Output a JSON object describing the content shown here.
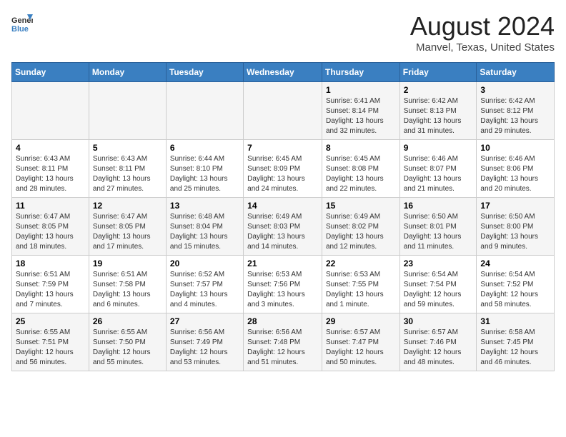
{
  "logo": {
    "text_general": "General",
    "text_blue": "Blue"
  },
  "header": {
    "title": "August 2024",
    "subtitle": "Manvel, Texas, United States"
  },
  "days_of_week": [
    "Sunday",
    "Monday",
    "Tuesday",
    "Wednesday",
    "Thursday",
    "Friday",
    "Saturday"
  ],
  "weeks": [
    [
      {
        "day": "",
        "info": ""
      },
      {
        "day": "",
        "info": ""
      },
      {
        "day": "",
        "info": ""
      },
      {
        "day": "",
        "info": ""
      },
      {
        "day": "1",
        "info": "Sunrise: 6:41 AM\nSunset: 8:14 PM\nDaylight: 13 hours\nand 32 minutes."
      },
      {
        "day": "2",
        "info": "Sunrise: 6:42 AM\nSunset: 8:13 PM\nDaylight: 13 hours\nand 31 minutes."
      },
      {
        "day": "3",
        "info": "Sunrise: 6:42 AM\nSunset: 8:12 PM\nDaylight: 13 hours\nand 29 minutes."
      }
    ],
    [
      {
        "day": "4",
        "info": "Sunrise: 6:43 AM\nSunset: 8:11 PM\nDaylight: 13 hours\nand 28 minutes."
      },
      {
        "day": "5",
        "info": "Sunrise: 6:43 AM\nSunset: 8:11 PM\nDaylight: 13 hours\nand 27 minutes."
      },
      {
        "day": "6",
        "info": "Sunrise: 6:44 AM\nSunset: 8:10 PM\nDaylight: 13 hours\nand 25 minutes."
      },
      {
        "day": "7",
        "info": "Sunrise: 6:45 AM\nSunset: 8:09 PM\nDaylight: 13 hours\nand 24 minutes."
      },
      {
        "day": "8",
        "info": "Sunrise: 6:45 AM\nSunset: 8:08 PM\nDaylight: 13 hours\nand 22 minutes."
      },
      {
        "day": "9",
        "info": "Sunrise: 6:46 AM\nSunset: 8:07 PM\nDaylight: 13 hours\nand 21 minutes."
      },
      {
        "day": "10",
        "info": "Sunrise: 6:46 AM\nSunset: 8:06 PM\nDaylight: 13 hours\nand 20 minutes."
      }
    ],
    [
      {
        "day": "11",
        "info": "Sunrise: 6:47 AM\nSunset: 8:05 PM\nDaylight: 13 hours\nand 18 minutes."
      },
      {
        "day": "12",
        "info": "Sunrise: 6:47 AM\nSunset: 8:05 PM\nDaylight: 13 hours\nand 17 minutes."
      },
      {
        "day": "13",
        "info": "Sunrise: 6:48 AM\nSunset: 8:04 PM\nDaylight: 13 hours\nand 15 minutes."
      },
      {
        "day": "14",
        "info": "Sunrise: 6:49 AM\nSunset: 8:03 PM\nDaylight: 13 hours\nand 14 minutes."
      },
      {
        "day": "15",
        "info": "Sunrise: 6:49 AM\nSunset: 8:02 PM\nDaylight: 13 hours\nand 12 minutes."
      },
      {
        "day": "16",
        "info": "Sunrise: 6:50 AM\nSunset: 8:01 PM\nDaylight: 13 hours\nand 11 minutes."
      },
      {
        "day": "17",
        "info": "Sunrise: 6:50 AM\nSunset: 8:00 PM\nDaylight: 13 hours\nand 9 minutes."
      }
    ],
    [
      {
        "day": "18",
        "info": "Sunrise: 6:51 AM\nSunset: 7:59 PM\nDaylight: 13 hours\nand 7 minutes."
      },
      {
        "day": "19",
        "info": "Sunrise: 6:51 AM\nSunset: 7:58 PM\nDaylight: 13 hours\nand 6 minutes."
      },
      {
        "day": "20",
        "info": "Sunrise: 6:52 AM\nSunset: 7:57 PM\nDaylight: 13 hours\nand 4 minutes."
      },
      {
        "day": "21",
        "info": "Sunrise: 6:53 AM\nSunset: 7:56 PM\nDaylight: 13 hours\nand 3 minutes."
      },
      {
        "day": "22",
        "info": "Sunrise: 6:53 AM\nSunset: 7:55 PM\nDaylight: 13 hours\nand 1 minute."
      },
      {
        "day": "23",
        "info": "Sunrise: 6:54 AM\nSunset: 7:54 PM\nDaylight: 12 hours\nand 59 minutes."
      },
      {
        "day": "24",
        "info": "Sunrise: 6:54 AM\nSunset: 7:52 PM\nDaylight: 12 hours\nand 58 minutes."
      }
    ],
    [
      {
        "day": "25",
        "info": "Sunrise: 6:55 AM\nSunset: 7:51 PM\nDaylight: 12 hours\nand 56 minutes."
      },
      {
        "day": "26",
        "info": "Sunrise: 6:55 AM\nSunset: 7:50 PM\nDaylight: 12 hours\nand 55 minutes."
      },
      {
        "day": "27",
        "info": "Sunrise: 6:56 AM\nSunset: 7:49 PM\nDaylight: 12 hours\nand 53 minutes."
      },
      {
        "day": "28",
        "info": "Sunrise: 6:56 AM\nSunset: 7:48 PM\nDaylight: 12 hours\nand 51 minutes."
      },
      {
        "day": "29",
        "info": "Sunrise: 6:57 AM\nSunset: 7:47 PM\nDaylight: 12 hours\nand 50 minutes."
      },
      {
        "day": "30",
        "info": "Sunrise: 6:57 AM\nSunset: 7:46 PM\nDaylight: 12 hours\nand 48 minutes."
      },
      {
        "day": "31",
        "info": "Sunrise: 6:58 AM\nSunset: 7:45 PM\nDaylight: 12 hours\nand 46 minutes."
      }
    ]
  ]
}
